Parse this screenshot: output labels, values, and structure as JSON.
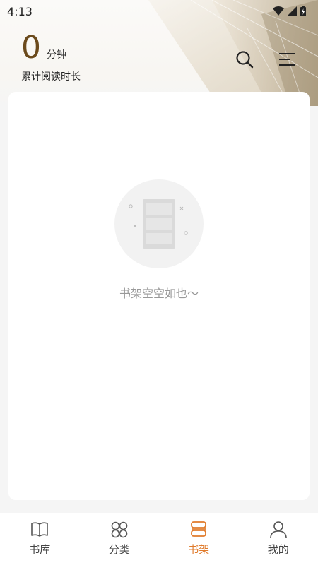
{
  "status_bar": {
    "time": "4:13"
  },
  "reading": {
    "value": "0",
    "unit": "分钟",
    "label": "累计阅读时长"
  },
  "empty_state": {
    "text": "书架空空如也～"
  },
  "tabs": [
    {
      "label": "书库",
      "icon": "book-open-icon",
      "active": false
    },
    {
      "label": "分类",
      "icon": "grid-circles-icon",
      "active": false
    },
    {
      "label": "书架",
      "icon": "bookshelf-icon",
      "active": true
    },
    {
      "label": "我的",
      "icon": "user-icon",
      "active": false
    }
  ],
  "colors": {
    "accent": "#e07b2c",
    "reading_value": "#6b4a1c",
    "muted_text": "#999999"
  }
}
